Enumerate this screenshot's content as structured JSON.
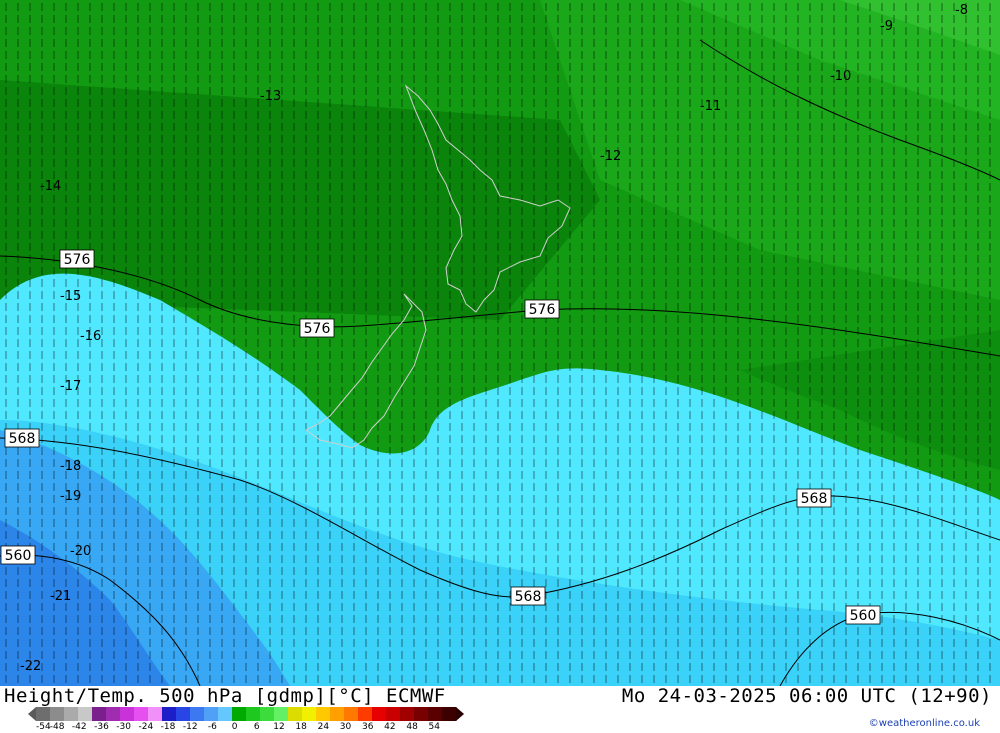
{
  "title": "Height/Temp. 500 hPa [gdmp][°C] ECMWF",
  "valid_time": "Mo 24-03-2025 06:00 UTC (12+90)",
  "credit": "©weatheronline.co.uk",
  "legend": {
    "ticks": [
      "-54",
      "-48",
      "-42",
      "-36",
      "-30",
      "-24",
      "-18",
      "-12",
      "-6",
      "0",
      "6",
      "12",
      "18",
      "24",
      "30",
      "36",
      "42",
      "48",
      "54"
    ],
    "colors": [
      "#6e6e6e",
      "#8c8c8c",
      "#aaaaaa",
      "#c8c8c8",
      "#7a1f8c",
      "#a02cb0",
      "#c832d8",
      "#e650f0",
      "#f090f8",
      "#1e1ec8",
      "#2846e6",
      "#3c78f0",
      "#50a0f8",
      "#64c8ff",
      "#00aa00",
      "#1ec81e",
      "#3cdc3c",
      "#64f064",
      "#dcdc00",
      "#f0f000",
      "#ffc800",
      "#ffa000",
      "#ff7800",
      "#ff3c00",
      "#e60000",
      "#c80000",
      "#a00000",
      "#780000",
      "#5a0000",
      "#3c0000"
    ]
  },
  "contour_labels": [
    "576",
    "576",
    "576",
    "568",
    "568",
    "568",
    "560",
    "560"
  ],
  "temperature_labels": [
    "-8",
    "-9",
    "-10",
    "-11",
    "-12",
    "-13",
    "-14",
    "-15",
    "-16",
    "-17",
    "-18",
    "-19",
    "-20",
    "-21",
    "-22"
  ]
}
